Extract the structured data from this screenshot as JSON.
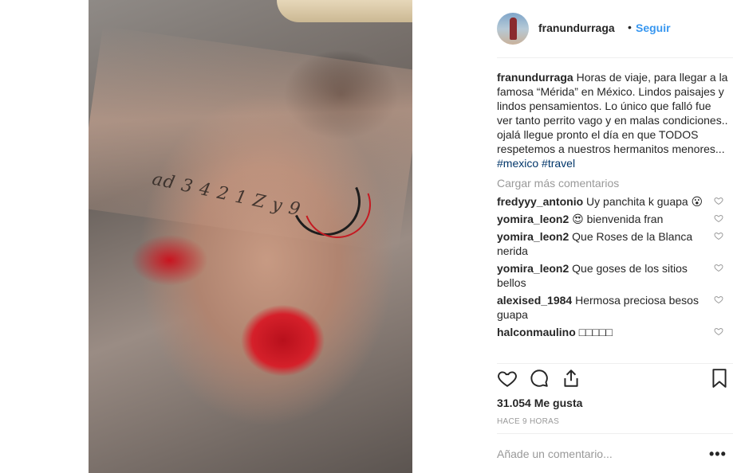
{
  "post": {
    "author": "franundurraga",
    "follow_label": "Seguir",
    "separator": "•",
    "caption_text": "Horas de viaje, para llegar a la famosa “Mérida” en México. Lindos paisajes y lindos pensamientos. Lo único que falló fue ver tanto perrito vago y en malas condiciones.. ojalá llegue pronto el día en que TODOS respetemos a nuestros hermanitos menores...",
    "hashtags": [
      "#mexico",
      "#travel"
    ],
    "tattoo_text": "ad 3 4 2 1 Z y 9",
    "load_more": "Cargar más comentarios",
    "comments": [
      {
        "user": "fredyyy_antonio",
        "text": "Uy panchita k guapa 😮"
      },
      {
        "user": "yomira_leon2",
        "text": "😍 bienvenida fran"
      },
      {
        "user": "yomira_leon2",
        "text": "Que Roses de la Blanca nerida"
      },
      {
        "user": "yomira_leon2",
        "text": "Que goses de los sitios bellos"
      },
      {
        "user": "alexised_1984",
        "text": "Hermosa preciosa besos guapa"
      },
      {
        "user": "halconmaulino",
        "text": "□□□□□"
      }
    ],
    "likes": "31.054 Me gusta",
    "time_ago": "HACE 9 HORAS",
    "add_comment_placeholder": "Añade un comentario...",
    "more_options": "•••"
  },
  "icons": {
    "like": "heart-icon",
    "comment": "comment-icon",
    "share": "share-icon",
    "save": "bookmark-icon",
    "comment_like": "heart-small-icon"
  },
  "colors": {
    "link_blue": "#3897f0",
    "hashtag": "#003569",
    "muted": "#999999",
    "text": "#262626"
  }
}
